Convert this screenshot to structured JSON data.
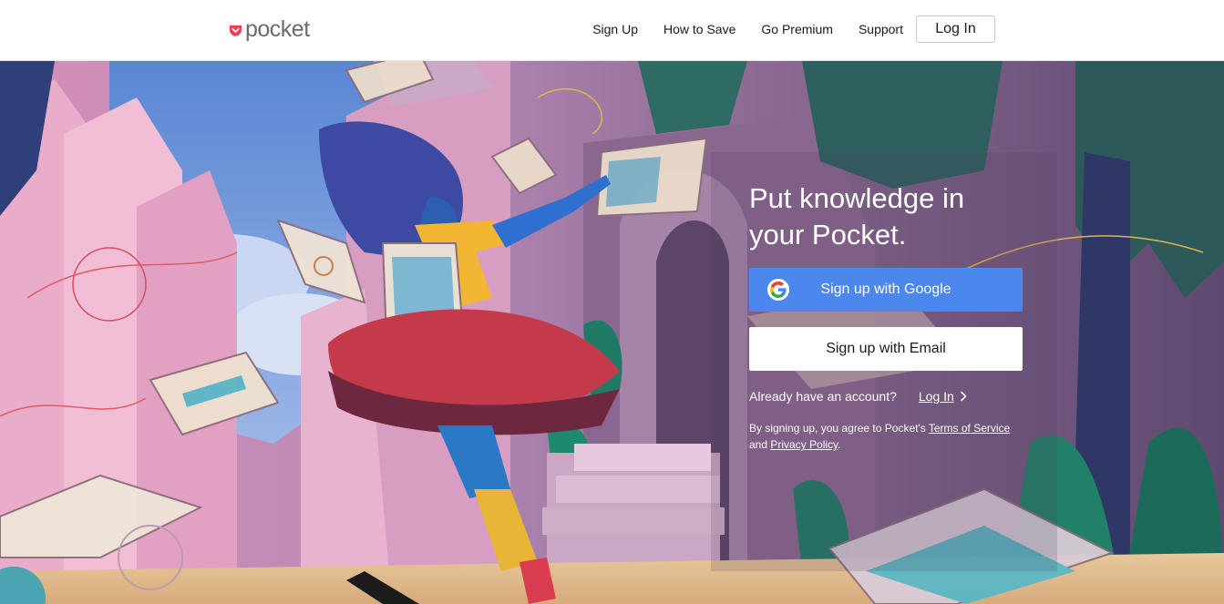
{
  "header": {
    "logo_text": "pocket",
    "nav": {
      "sign_up": "Sign Up",
      "how_to_save": "How to Save",
      "go_premium": "Go Premium",
      "support": "Support"
    },
    "login_label": "Log In"
  },
  "hero": {
    "headline": "Put knowledge in your Pocket.",
    "google_button": "Sign up with Google",
    "email_button": "Sign up with Email",
    "account_prompt": "Already have an account?",
    "account_login": "Log In",
    "legal": {
      "prefix": "By signing up, you agree to Pocket's ",
      "terms": "Terms of Service",
      "middle": " and ",
      "privacy": "Privacy Policy",
      "suffix": "."
    }
  },
  "colors": {
    "brand_red": "#ef4056",
    "google_blue": "#4c87ee",
    "hero_purple": "#7a5a86"
  },
  "icons": [
    "pocket-logo-icon",
    "google-g-icon",
    "chevron-right-icon"
  ]
}
